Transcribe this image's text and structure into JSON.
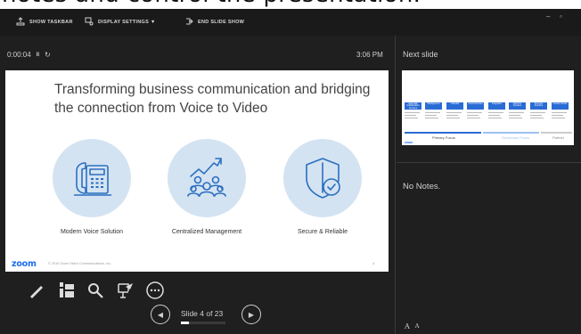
{
  "caption": {
    "text": "notes and control the presentation."
  },
  "toolbar": {
    "show_taskbar": "SHOW TASKBAR",
    "display_settings": "DISPLAY SETTINGS ▼",
    "end_slide_show": "END SLIDE SHOW",
    "minimize": "–",
    "restore": "▫"
  },
  "timer": {
    "elapsed": "0:00:04",
    "pause": "II",
    "reset": "↻"
  },
  "clock": "3:06 PM",
  "next_slide": {
    "label": "Next slide",
    "columns": [
      "Essential Collaboration Services",
      "Management",
      "Calendar",
      "Cloud Services",
      "Integration",
      "Paid Tier Services",
      "Premium Services",
      "Custom Needs"
    ],
    "footer_labels": [
      "Primary Focus",
      "Secondary Focus",
      "Partner"
    ]
  },
  "slide": {
    "title": "Transforming business communication and bridging the connection from Voice to Video",
    "features": [
      "Modern Voice Solution",
      "Centralized Management",
      "Secure & Reliable"
    ],
    "logo": "zoom",
    "copyright": "© 2019 Zoom Video Communications, Inc.",
    "page_number": "4"
  },
  "notes": {
    "text": "No Notes."
  },
  "font_controls": {
    "increase": "A",
    "decrease": "A"
  },
  "navigation": {
    "slide_counter": "Slide 4 of 23",
    "progress_fraction": 0.174
  },
  "colors": {
    "background": "#1f1f1f",
    "toolbar": "#1a1a1a",
    "accent": "#1b6df0",
    "circle": "#d4e3f2",
    "icon_stroke": "#2b6fc0"
  },
  "icons": [
    "taskbar-icon",
    "display-settings-icon",
    "end-show-icon",
    "pen-icon",
    "see-all-slides-icon",
    "zoom-icon",
    "pointer-icon",
    "more-options-icon",
    "previous-slide-icon",
    "next-slide-icon"
  ]
}
